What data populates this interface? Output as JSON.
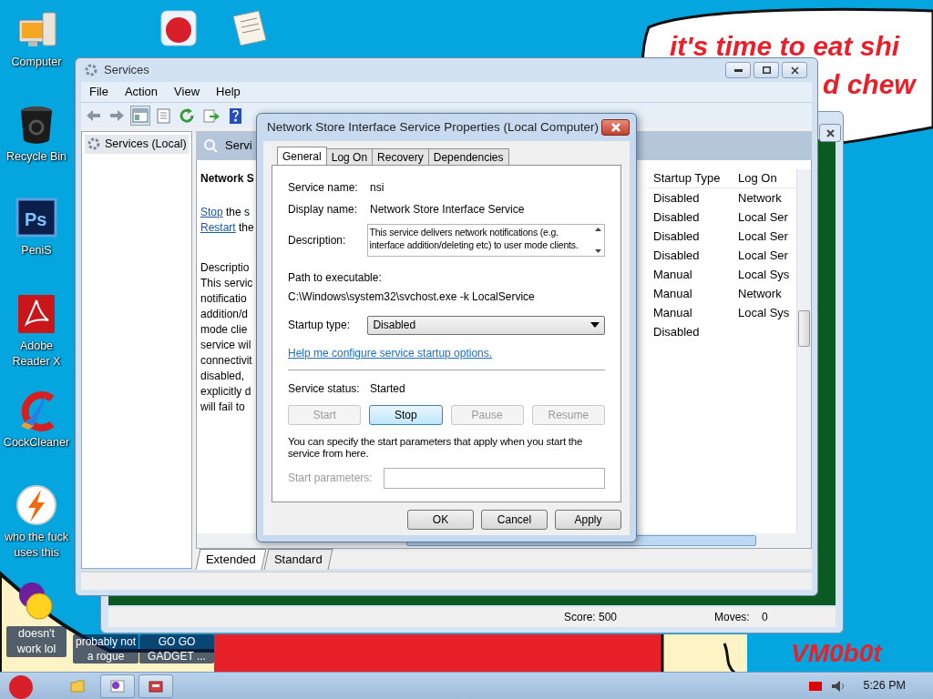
{
  "wallpaper": {
    "bubble_lines": [
      "it's time to eat shi",
      "d chew"
    ],
    "signature": "VM0b0t"
  },
  "desktop_icons": [
    {
      "label": "Computer",
      "kind": "computer"
    },
    {
      "label": "Recycle Bin",
      "kind": "trash"
    },
    {
      "label": "PeniS",
      "kind": "ps",
      "logo_text": "Ps"
    },
    {
      "label": "Adobe Reader X",
      "kind": "pdf"
    },
    {
      "label": "CockCleaner",
      "kind": "cleaner"
    },
    {
      "label": "who the fuck uses this",
      "kind": "bolt"
    },
    {
      "label": "doesn't work lol",
      "kind": "messenger"
    }
  ],
  "bottom_icons": [
    {
      "label": "probably not a rogue"
    },
    {
      "label": "GO GO GADGET ..."
    }
  ],
  "top_icons": [
    {
      "kind": "bird"
    },
    {
      "kind": "document"
    }
  ],
  "game_window": {
    "status": [
      "Score: 500",
      "Moves: 0"
    ]
  },
  "services_window": {
    "title": "Services",
    "menu": [
      "File",
      "Action",
      "View",
      "Help"
    ],
    "tree": [
      {
        "label": "Services (Local)",
        "selected": true
      }
    ],
    "header": "Servi",
    "service_title": "Network S",
    "actions": [
      {
        "link": "Stop",
        "rest": "the s"
      },
      {
        "link": "Restart",
        "rest": "the"
      }
    ],
    "description_lines": [
      "Descriptio",
      "This servic",
      "notificatio",
      "addition/d",
      "mode clie",
      "service wil",
      "connectivit",
      "disabled,",
      "explicitly d",
      "will fail to"
    ],
    "columns": [
      "Startup Type",
      "Log On"
    ],
    "rows": [
      [
        "Disabled",
        "Network"
      ],
      [
        "Disabled",
        "Local Ser"
      ],
      [
        "Disabled",
        "Local Ser"
      ],
      [
        "Disabled",
        "Local Ser"
      ],
      [
        "Manual",
        "Local Sys"
      ],
      [
        "Manual",
        "Network"
      ],
      [
        "Manual",
        "Local Sys"
      ],
      [
        "Disabled",
        ""
      ]
    ],
    "view_tabs": [
      {
        "label": "Extended",
        "selected": true
      },
      {
        "label": "Standard",
        "selected": false
      }
    ]
  },
  "dialog": {
    "title": "Network Store Interface Service Properties (Local Computer)",
    "tabs": [
      {
        "label": "General",
        "selected": true
      },
      {
        "label": "Log On",
        "selected": false
      },
      {
        "label": "Recovery",
        "selected": false
      },
      {
        "label": "Dependencies",
        "selected": false
      }
    ],
    "service_name_label": "Service name:",
    "service_name": "nsi",
    "display_name_label": "Display name:",
    "display_name": "Network Store Interface Service",
    "description_label": "Description:",
    "description": "This service delivers network notifications (e.g. interface addition/deleting etc) to user mode clients.",
    "path_label": "Path to executable:",
    "path": "C:\\Windows\\system32\\svchost.exe -k LocalService",
    "startup_label": "Startup type:",
    "startup_type": "Disabled",
    "help_link": "Help me configure service startup options.",
    "status_label": "Service status:",
    "status": "Started",
    "control_buttons": [
      {
        "label": "Start",
        "disabled": true,
        "focused": false
      },
      {
        "label": "Stop",
        "disabled": false,
        "focused": true
      },
      {
        "label": "Pause",
        "disabled": true,
        "focused": false
      },
      {
        "label": "Resume",
        "disabled": true,
        "focused": false
      }
    ],
    "note": "You can specify the start parameters that apply when you start the service from here.",
    "params_label": "Start parameters:",
    "params_disabled": true,
    "buttons": [
      "OK",
      "Cancel",
      "Apply"
    ]
  },
  "taskbar": {
    "clock": "5:26 PM"
  }
}
